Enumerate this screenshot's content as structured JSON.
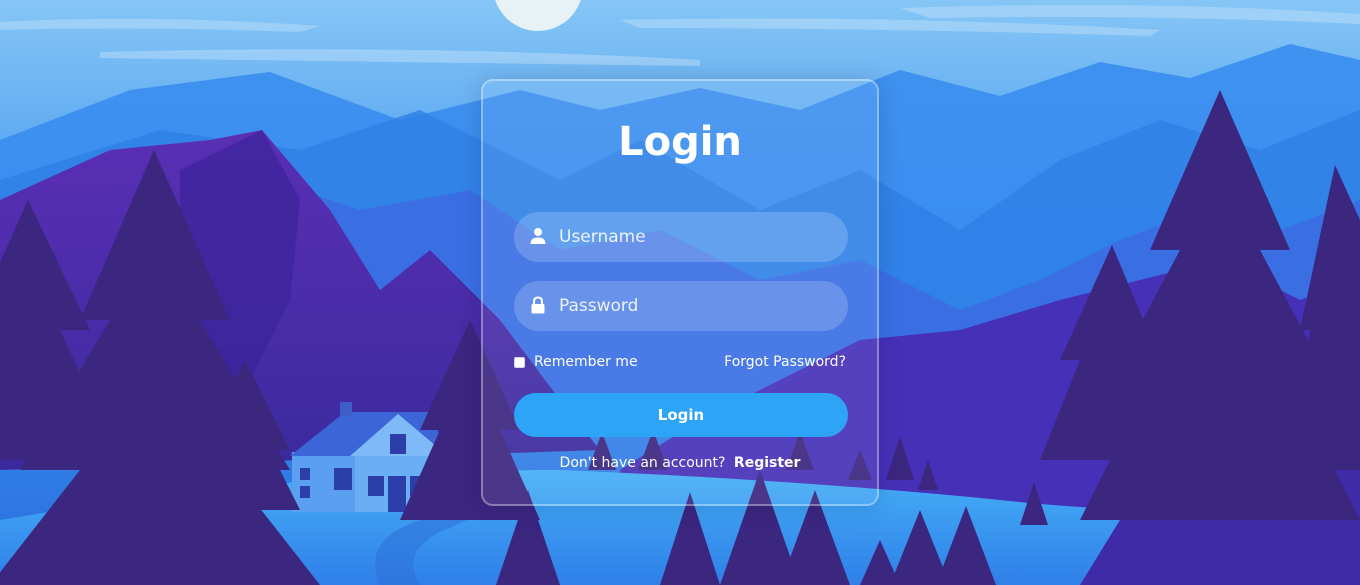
{
  "colors": {
    "sky_top": "#7fc2f5",
    "sky_bottom": "#2b7ae6",
    "mountain_far": "#3b8ff0",
    "mountain_mid": "#4a5fe0",
    "mountain_purple": "#4a2db8",
    "tree_dark": "#3b2680",
    "ground_light": "#3da8f5",
    "button_accent": "#2ea4f7",
    "text": "#ffffff"
  },
  "login": {
    "title": "Login",
    "username": {
      "placeholder": "Username",
      "value": "",
      "icon": "user-icon"
    },
    "password": {
      "placeholder": "Password",
      "value": "",
      "icon": "lock-icon"
    },
    "remember_label": "Remember me",
    "remember_checked": false,
    "forgot_label": "Forgot Password?",
    "submit_label": "Login",
    "register_prompt": "Don't have an account?",
    "register_label": "Register"
  }
}
